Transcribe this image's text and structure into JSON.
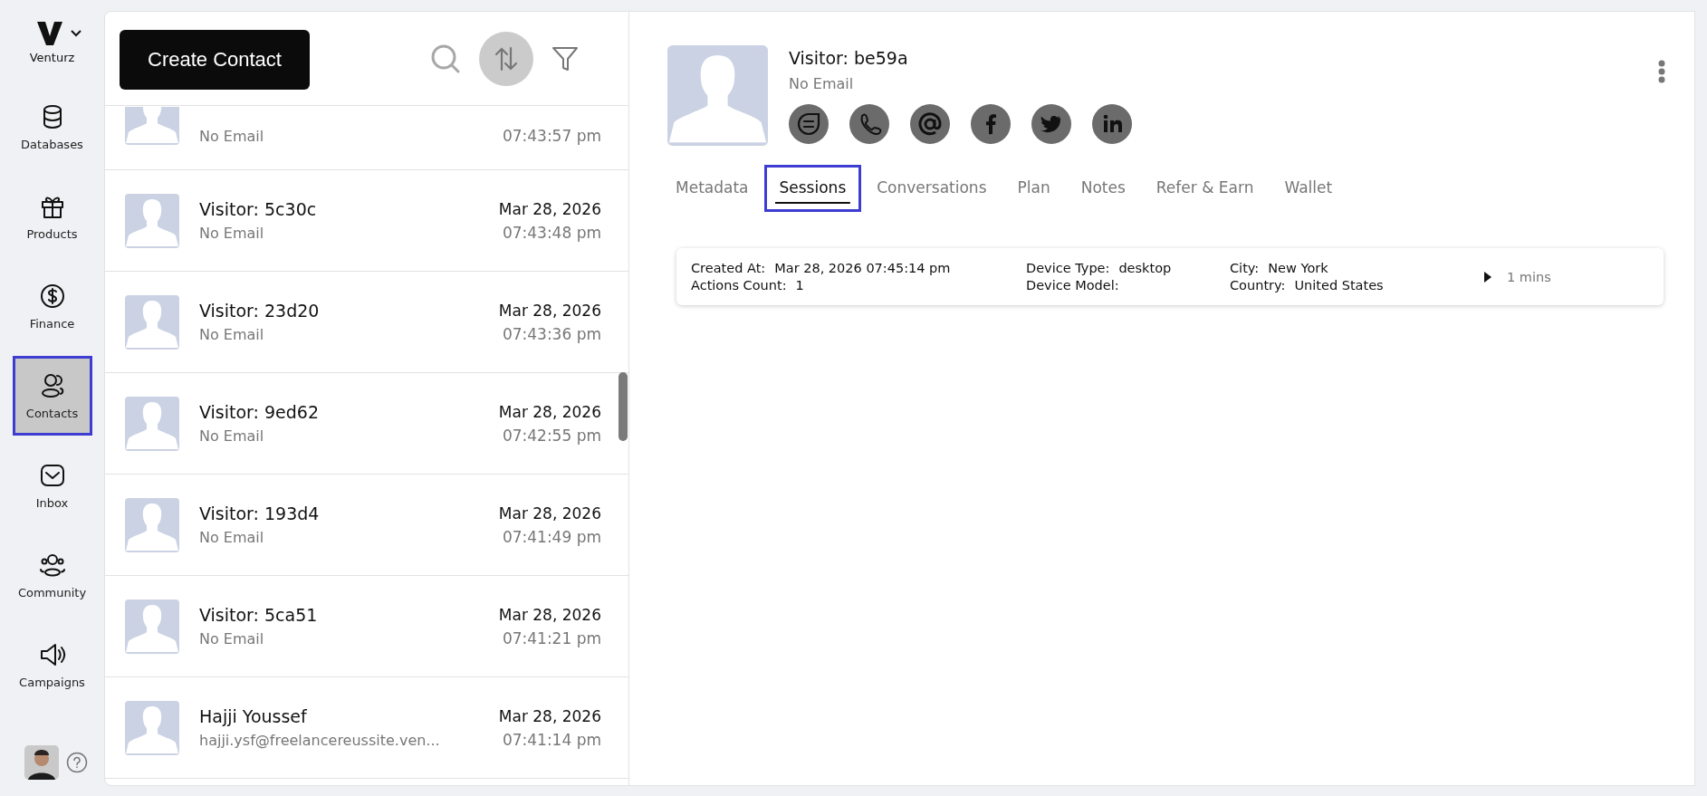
{
  "sidebar": {
    "brand": "Venturz",
    "items": [
      {
        "label": "Databases",
        "selected": false
      },
      {
        "label": "Products",
        "selected": false
      },
      {
        "label": "Finance",
        "selected": false
      },
      {
        "label": "Contacts",
        "selected": true
      },
      {
        "label": "Inbox",
        "selected": false
      },
      {
        "label": "Community",
        "selected": false
      },
      {
        "label": "Campaigns",
        "selected": false
      }
    ]
  },
  "contact_list": {
    "create_button": "Create Contact",
    "rows": [
      {
        "email": "No Email",
        "time": "07:43:57 pm"
      },
      {
        "name": "Visitor: 5c30c",
        "email": "No Email",
        "date": "Mar 28, 2026",
        "time": "07:43:48 pm"
      },
      {
        "name": "Visitor: 23d20",
        "email": "No Email",
        "date": "Mar 28, 2026",
        "time": "07:43:36 pm"
      },
      {
        "name": "Visitor: 9ed62",
        "email": "No Email",
        "date": "Mar 28, 2026",
        "time": "07:42:55 pm"
      },
      {
        "name": "Visitor: 193d4",
        "email": "No Email",
        "date": "Mar 28, 2026",
        "time": "07:41:49 pm"
      },
      {
        "name": "Visitor: 5ca51",
        "email": "No Email",
        "date": "Mar 28, 2026",
        "time": "07:41:21 pm"
      },
      {
        "name": "Hajji Youssef",
        "email": "hajji.ysf@freelancereussite.ven...",
        "date": "Mar 28, 2026",
        "time": "07:41:14 pm"
      }
    ]
  },
  "detail": {
    "name": "Visitor: be59a",
    "email": "No Email",
    "tabs": [
      {
        "label": "Metadata",
        "selected": false
      },
      {
        "label": "Sessions",
        "selected": true
      },
      {
        "label": "Conversations",
        "selected": false
      },
      {
        "label": "Plan",
        "selected": false
      },
      {
        "label": "Notes",
        "selected": false
      },
      {
        "label": "Refer & Earn",
        "selected": false
      },
      {
        "label": "Wallet",
        "selected": false
      }
    ],
    "session": {
      "fields": [
        {
          "label": "Created At:",
          "value": "Mar 28, 2026 07:45:14 pm"
        },
        {
          "label": "Actions Count:",
          "value": "1"
        },
        {
          "label": "Device Type:",
          "value": "desktop"
        },
        {
          "label": "Device Model:"
        },
        {
          "label": "City:",
          "value": "New York"
        },
        {
          "label": "Country:",
          "value": "United States"
        }
      ],
      "duration": "1 mins"
    }
  }
}
